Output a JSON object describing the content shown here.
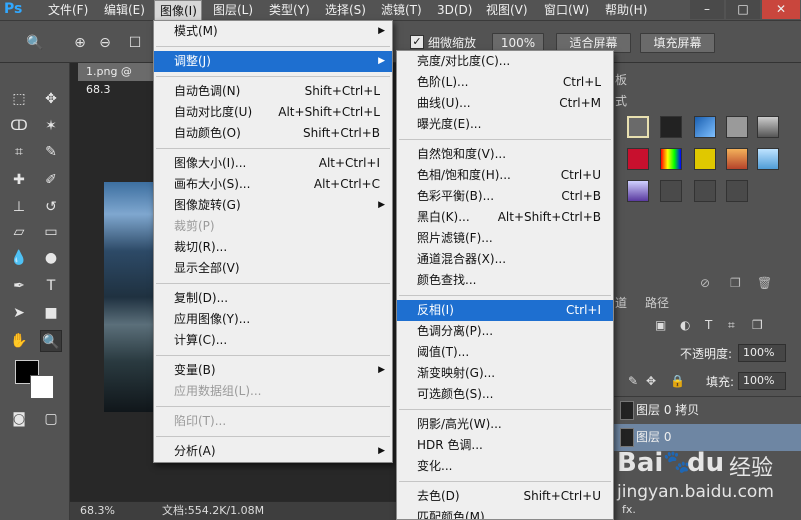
{
  "menubar": {
    "logo": "Ps",
    "items": [
      "文件(F)",
      "编辑(E)",
      "图像(I)",
      "图层(L)",
      "类型(Y)",
      "选择(S)",
      "滤镜(T)",
      "3D(D)",
      "视图(V)",
      "窗口(W)",
      "帮助(H)"
    ],
    "window_buttons": [
      "–",
      "□",
      "✕"
    ]
  },
  "optbar": {
    "checkbox_label": "细微缩放",
    "btn_100": "100%",
    "btn_fit": "适合屏幕",
    "btn_fill": "填充屏幕"
  },
  "document": {
    "tab": "1.png @ 68.3",
    "zoom": "68.3%",
    "doc_info": "文档:554.2K/1.08M"
  },
  "panels": {
    "tab_fragment_1": "板",
    "tab_fragment_2": "式",
    "tab_channels_frag": "道",
    "tab_paths": "路径",
    "opacity_label": "不透明度:",
    "opacity_value": "100%",
    "fill_label": "填充:",
    "fill_value": "100%",
    "layers": [
      {
        "name": "图层 0 拷贝"
      },
      {
        "name": "图层 0"
      }
    ],
    "fx_label": "fx."
  },
  "image_menu": {
    "items": [
      {
        "label": "模式(M)",
        "shortcut": "",
        "submenu": true,
        "disabled": false,
        "highlight": false
      },
      {
        "sep": true
      },
      {
        "label": "调整(J)",
        "shortcut": "",
        "submenu": true,
        "disabled": false,
        "highlight": true
      },
      {
        "sep": true
      },
      {
        "label": "自动色调(N)",
        "shortcut": "Shift+Ctrl+L",
        "submenu": false,
        "disabled": false,
        "highlight": false
      },
      {
        "label": "自动对比度(U)",
        "shortcut": "Alt+Shift+Ctrl+L",
        "submenu": false,
        "disabled": false,
        "highlight": false
      },
      {
        "label": "自动颜色(O)",
        "shortcut": "Shift+Ctrl+B",
        "submenu": false,
        "disabled": false,
        "highlight": false
      },
      {
        "sep": true
      },
      {
        "label": "图像大小(I)...",
        "shortcut": "Alt+Ctrl+I",
        "submenu": false,
        "disabled": false,
        "highlight": false
      },
      {
        "label": "画布大小(S)...",
        "shortcut": "Alt+Ctrl+C",
        "submenu": false,
        "disabled": false,
        "highlight": false
      },
      {
        "label": "图像旋转(G)",
        "shortcut": "",
        "submenu": true,
        "disabled": false,
        "highlight": false
      },
      {
        "label": "裁剪(P)",
        "shortcut": "",
        "submenu": false,
        "disabled": true,
        "highlight": false
      },
      {
        "label": "裁切(R)...",
        "shortcut": "",
        "submenu": false,
        "disabled": false,
        "highlight": false
      },
      {
        "label": "显示全部(V)",
        "shortcut": "",
        "submenu": false,
        "disabled": false,
        "highlight": false
      },
      {
        "sep": true
      },
      {
        "label": "复制(D)...",
        "shortcut": "",
        "submenu": false,
        "disabled": false,
        "highlight": false
      },
      {
        "label": "应用图像(Y)...",
        "shortcut": "",
        "submenu": false,
        "disabled": false,
        "highlight": false
      },
      {
        "label": "计算(C)...",
        "shortcut": "",
        "submenu": false,
        "disabled": false,
        "highlight": false
      },
      {
        "sep": true
      },
      {
        "label": "变量(B)",
        "shortcut": "",
        "submenu": true,
        "disabled": false,
        "highlight": false
      },
      {
        "label": "应用数据组(L)...",
        "shortcut": "",
        "submenu": false,
        "disabled": true,
        "highlight": false
      },
      {
        "sep": true
      },
      {
        "label": "陷印(T)...",
        "shortcut": "",
        "submenu": false,
        "disabled": true,
        "highlight": false
      },
      {
        "sep": true
      },
      {
        "label": "分析(A)",
        "shortcut": "",
        "submenu": true,
        "disabled": false,
        "highlight": false
      }
    ]
  },
  "adjust_menu": {
    "items": [
      {
        "label": "亮度/对比度(C)...",
        "shortcut": "",
        "highlight": false
      },
      {
        "label": "色阶(L)...",
        "shortcut": "Ctrl+L",
        "highlight": false
      },
      {
        "label": "曲线(U)...",
        "shortcut": "Ctrl+M",
        "highlight": false
      },
      {
        "label": "曝光度(E)...",
        "shortcut": "",
        "highlight": false
      },
      {
        "sep": true
      },
      {
        "label": "自然饱和度(V)...",
        "shortcut": "",
        "highlight": false
      },
      {
        "label": "色相/饱和度(H)...",
        "shortcut": "Ctrl+U",
        "highlight": false
      },
      {
        "label": "色彩平衡(B)...",
        "shortcut": "Ctrl+B",
        "highlight": false
      },
      {
        "label": "黑白(K)...",
        "shortcut": "Alt+Shift+Ctrl+B",
        "highlight": false
      },
      {
        "label": "照片滤镜(F)...",
        "shortcut": "",
        "highlight": false
      },
      {
        "label": "通道混合器(X)...",
        "shortcut": "",
        "highlight": false
      },
      {
        "label": "颜色查找...",
        "shortcut": "",
        "highlight": false
      },
      {
        "sep": true
      },
      {
        "label": "反相(I)",
        "shortcut": "Ctrl+I",
        "highlight": true
      },
      {
        "label": "色调分离(P)...",
        "shortcut": "",
        "highlight": false
      },
      {
        "label": "阈值(T)...",
        "shortcut": "",
        "highlight": false
      },
      {
        "label": "渐变映射(G)...",
        "shortcut": "",
        "highlight": false
      },
      {
        "label": "可选颜色(S)...",
        "shortcut": "",
        "highlight": false
      },
      {
        "sep": true
      },
      {
        "label": "阴影/高光(W)...",
        "shortcut": "",
        "highlight": false
      },
      {
        "label": "HDR 色调...",
        "shortcut": "",
        "highlight": false
      },
      {
        "label": "变化...",
        "shortcut": "",
        "highlight": false
      },
      {
        "sep": true
      },
      {
        "label": "去色(D)",
        "shortcut": "Shift+Ctrl+U",
        "highlight": false
      },
      {
        "label": "匹配颜色(M)...",
        "shortcut": "",
        "highlight": false
      }
    ]
  },
  "watermark": {
    "brand": "Bai",
    "brand2": "du",
    "cn": "经验",
    "url": "jingyan.baidu.com"
  },
  "colors": {
    "highlight": "#1e6fd0",
    "ps_blue": "#31a8ff"
  }
}
